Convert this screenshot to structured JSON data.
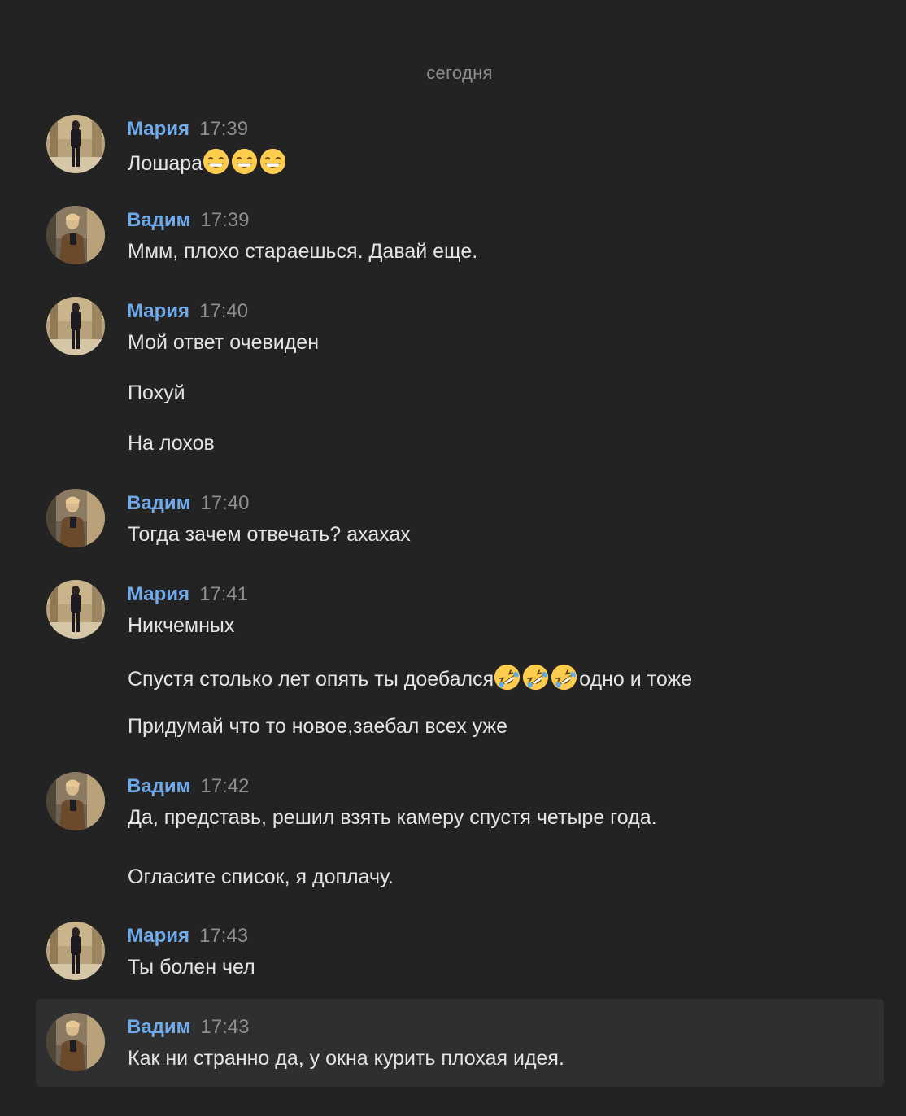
{
  "date_separator": "сегодня",
  "colors": {
    "background": "#232323",
    "highlight": "#2f2f30",
    "author": "#71aaeb",
    "time": "#8c8e91",
    "text": "#e1e3e6"
  },
  "messages": [
    {
      "author": "Мария",
      "time": "17:39",
      "avatar": "avatar-maria",
      "lines": [
        "Лошара"
      ],
      "emoji": "grinning-face-with-smiling-eyes-emoji ×3"
    },
    {
      "author": "Вадим",
      "time": "17:39",
      "avatar": "avatar-vadim",
      "lines": [
        "Ммм, плохо стараешься. Давай еще."
      ]
    },
    {
      "author": "Мария",
      "time": "17:40",
      "avatar": "avatar-maria",
      "lines": [
        "Мой ответ очевиден",
        "Похуй",
        "На лохов"
      ]
    },
    {
      "author": "Вадим",
      "time": "17:40",
      "avatar": "avatar-vadim",
      "lines": [
        "Тогда зачем отвечать? ахахах"
      ]
    },
    {
      "author": "Мария",
      "time": "17:41",
      "avatar": "avatar-maria",
      "lines": [
        "Никчемных",
        "Спустя столько лет опять ты доебался",
        "одно и тоже",
        "Придумай что то новое,заебал всех уже"
      ],
      "emoji": "rolling-on-floor-laughing-emoji ×3"
    },
    {
      "author": "Вадим",
      "time": "17:42",
      "avatar": "avatar-vadim",
      "lines": [
        "Да, представь, решил взять камеру спустя четыре года.",
        "Огласите список, я доплачу."
      ]
    },
    {
      "author": "Мария",
      "time": "17:43",
      "avatar": "avatar-maria",
      "lines": [
        "Ты болен чел"
      ]
    },
    {
      "author": "Вадим",
      "time": "17:43",
      "avatar": "avatar-vadim",
      "lines": [
        "Как ни странно да, у окна курить плохая идея."
      ],
      "highlighted": true
    }
  ]
}
